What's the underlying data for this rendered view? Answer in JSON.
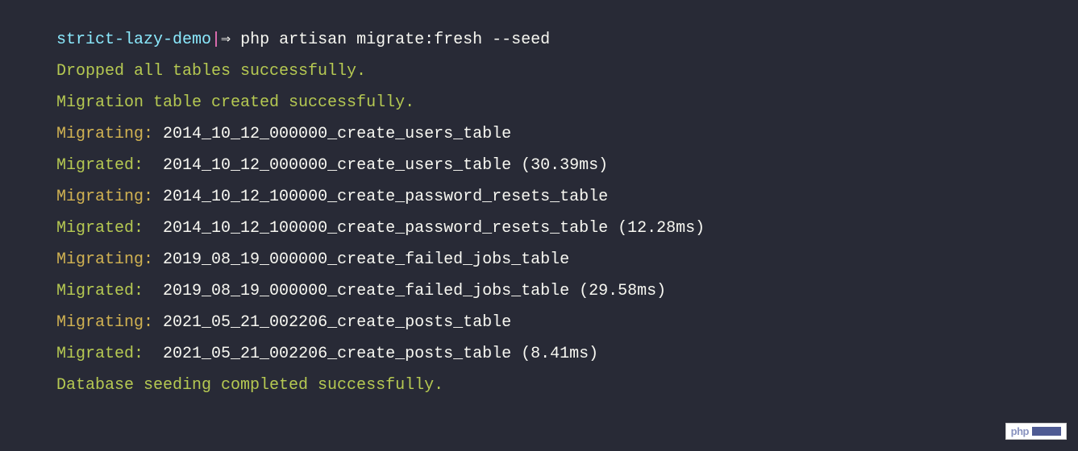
{
  "prompt": {
    "branch": "strict-lazy-demo",
    "separator": "|",
    "arrow": "⇒ ",
    "command": "php artisan migrate:fresh --seed"
  },
  "lines": [
    {
      "type": "green",
      "text": "Dropped all tables successfully."
    },
    {
      "type": "green",
      "text": "Migration table created successfully."
    },
    {
      "type": "migrating",
      "label": "Migrating:",
      "name": " 2014_10_12_000000_create_users_table"
    },
    {
      "type": "migrated",
      "label": "Migrated:",
      "name": "  2014_10_12_000000_create_users_table (30.39ms)"
    },
    {
      "type": "migrating",
      "label": "Migrating:",
      "name": " 2014_10_12_100000_create_password_resets_table"
    },
    {
      "type": "migrated",
      "label": "Migrated:",
      "name": "  2014_10_12_100000_create_password_resets_table (12.28ms)"
    },
    {
      "type": "migrating",
      "label": "Migrating:",
      "name": " 2019_08_19_000000_create_failed_jobs_table"
    },
    {
      "type": "migrated",
      "label": "Migrated:",
      "name": "  2019_08_19_000000_create_failed_jobs_table (29.58ms)"
    },
    {
      "type": "migrating",
      "label": "Migrating:",
      "name": " 2021_05_21_002206_create_posts_table"
    },
    {
      "type": "migrated",
      "label": "Migrated:",
      "name": "  2021_05_21_002206_create_posts_table (8.41ms)"
    },
    {
      "type": "green",
      "text": "Database seeding completed successfully."
    }
  ],
  "watermark": {
    "text": "php"
  }
}
